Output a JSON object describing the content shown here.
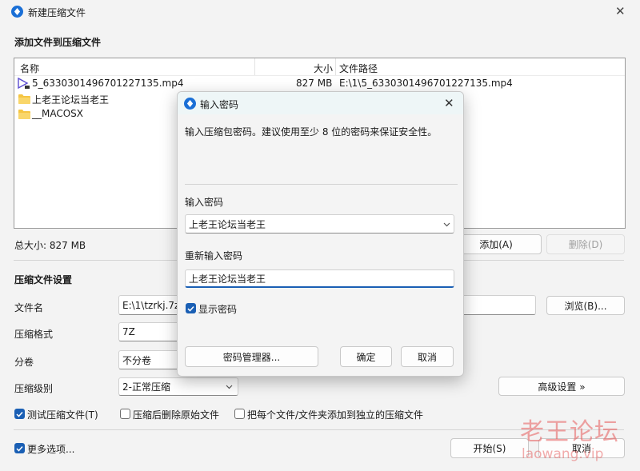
{
  "window": {
    "title": "新建压缩文件",
    "close_glyph": "✕"
  },
  "files_section": {
    "title": "添加文件到压缩文件",
    "columns": {
      "name": "名称",
      "size": "大小",
      "path": "文件路径"
    },
    "rows": [
      {
        "icon": "video-file-icon",
        "name": "5_6330301496701227135.mp4",
        "size": "827 MB",
        "path": "E:\\1\\5_6330301496701227135.mp4"
      },
      {
        "icon": "folder-icon",
        "name": "上老王论坛当老王",
        "size": "",
        "path": ""
      },
      {
        "icon": "folder-icon",
        "name": "__MACOSX",
        "size": "",
        "path": ""
      }
    ],
    "total_size": "总大小: 827 MB",
    "add_label": "添加(A)",
    "remove_label": "删除(D)"
  },
  "settings_section": {
    "title": "压缩文件设置",
    "filename_label": "文件名",
    "filename_value": "E:\\1\\tzrkj.7z",
    "browse_label": "浏览(B)...",
    "format_label": "压缩格式",
    "format_value": "7Z",
    "volume_label": "分卷",
    "volume_value": "不分卷",
    "level_label": "压缩级别",
    "level_value": "2-正常压缩",
    "advanced_label": "高级设置 »",
    "test_label": "测试压缩文件(T)",
    "delete_source_label": "压缩后删除原始文件",
    "separate_label": "把每个文件/文件夹添加到独立的压缩文件",
    "more_options_label": "更多选项...",
    "start_label": "开始(S)",
    "cancel_label": "取消"
  },
  "dialog": {
    "title": "输入密码",
    "close_glyph": "✕",
    "hint": "输入压缩包密码。建议使用至少 8 位的密码来保证安全性。",
    "password_label": "输入密码",
    "password_value": "上老王论坛当老王",
    "repeat_label": "重新输入密码",
    "repeat_value": "上老王论坛当老王",
    "show_password_label": "显示密码",
    "manager_label": "密码管理器...",
    "ok_label": "确定",
    "cancel_label": "取消"
  },
  "watermark": {
    "text1": "老王论坛",
    "text2": "laowang.vip"
  },
  "colors": {
    "accent": "#1a5fb4",
    "app_icon": "#1a6fd6",
    "watermark": "#e65a5a"
  }
}
